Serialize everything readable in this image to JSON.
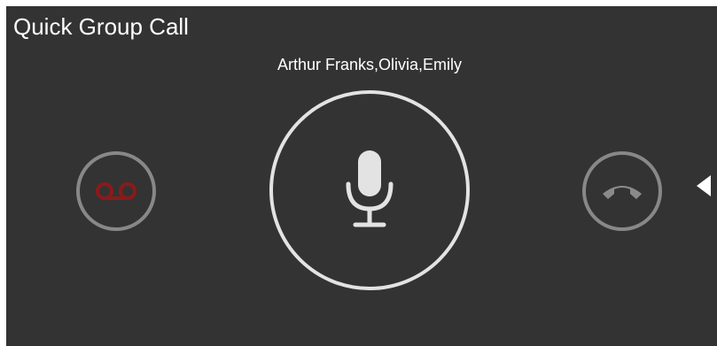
{
  "call": {
    "title": "Quick Group Call",
    "participants": "Arthur Franks,Olivia,Emily"
  },
  "controls": {
    "voicemail": {
      "icon": "voicemail-icon",
      "color": "#8b1a1a"
    },
    "mute": {
      "icon": "microphone-icon",
      "color": "#e3e3e3"
    },
    "hangup": {
      "icon": "phone-hangup-icon",
      "color": "#8a8a8a"
    },
    "collapse": {
      "icon": "left-arrow-icon",
      "color": "#ffffff"
    }
  },
  "colors": {
    "background": "#333333",
    "text": "#ffffff"
  }
}
